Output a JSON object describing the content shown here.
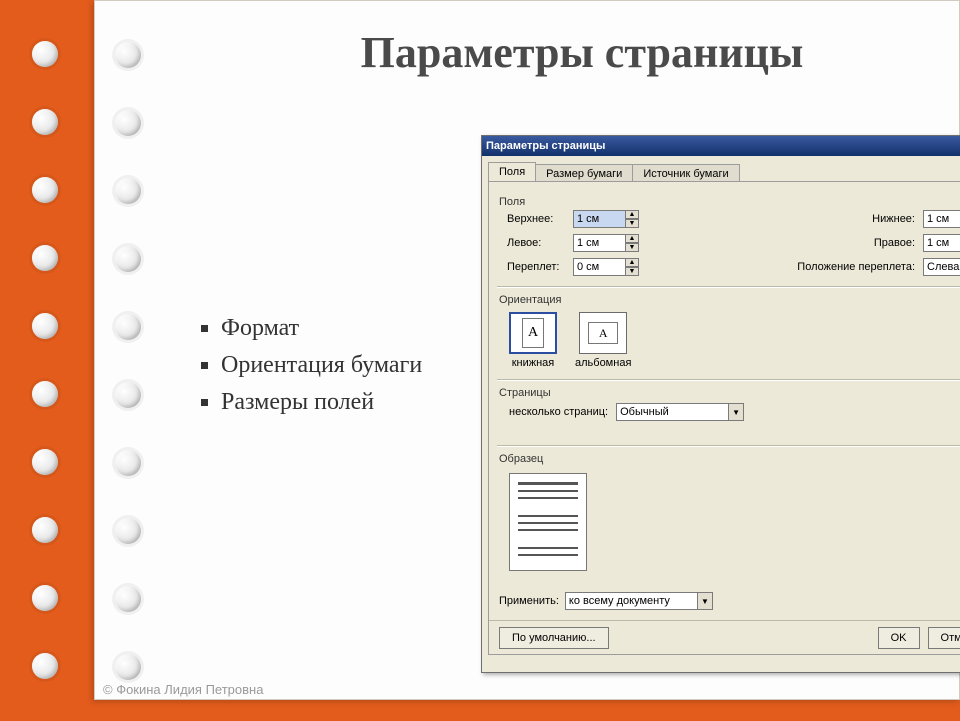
{
  "slide": {
    "title": "Параметры страницы",
    "bullets": [
      "Формат",
      "Ориентация бумаги",
      "Размеры полей"
    ],
    "footer": "© Фокина Лидия Петровна"
  },
  "dialog": {
    "title": "Параметры страницы",
    "titlebar_help": "?",
    "titlebar_close": "×",
    "tabs": {
      "fields": "Поля",
      "papersize": "Размер бумаги",
      "papersrc": "Источник бумаги"
    },
    "group_fields": "Поля",
    "labels": {
      "top": "Верхнее:",
      "bottom": "Нижнее:",
      "left": "Левое:",
      "right": "Правое:",
      "gutter": "Переплет:",
      "gutter_pos": "Положение переплета:"
    },
    "values": {
      "top": "1 см",
      "bottom": "1 см",
      "left": "1 см",
      "right": "1 см",
      "gutter": "0 см",
      "gutter_pos": "Слева"
    },
    "group_orient": "Ориентация",
    "orientation": {
      "portrait": "книжная",
      "landscape": "альбомная",
      "glyph": "A"
    },
    "group_pages": "Страницы",
    "pages_label": "несколько страниц:",
    "pages_value": "Обычный",
    "group_preview": "Образец",
    "apply_label": "Применить:",
    "apply_value": "ко всему документу",
    "btn_default": "По умолчанию...",
    "btn_ok": "OK",
    "btn_cancel": "Отмена"
  }
}
